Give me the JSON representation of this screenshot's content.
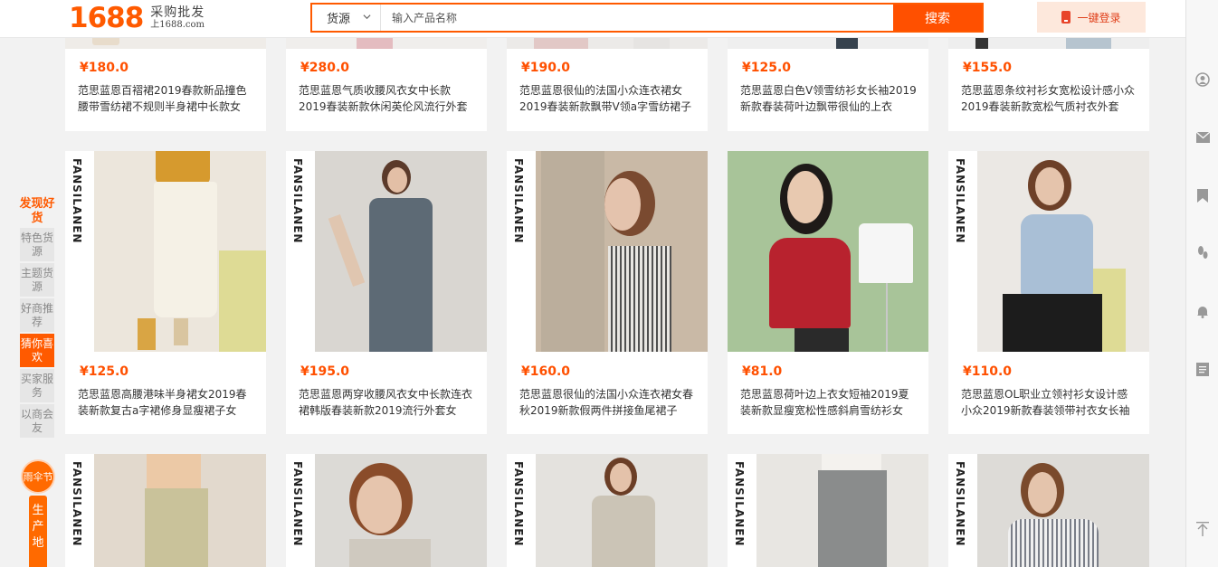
{
  "header": {
    "logo_number": "1688",
    "logo_slogan": "采购批发",
    "logo_url": "上1688.com",
    "search_category": "货源",
    "search_placeholder": "输入产品名称",
    "search_button": "搜索",
    "login_label": "一键登录"
  },
  "left_nav": {
    "title": "发现好货",
    "items": [
      {
        "label": "特色货源",
        "active": false
      },
      {
        "label": "主题货源",
        "active": false
      },
      {
        "label": "好商推荐",
        "active": false
      },
      {
        "label": "猜你喜欢",
        "active": true
      },
      {
        "label": "买家服务",
        "active": false
      },
      {
        "label": "以商会友",
        "active": false
      }
    ],
    "promo_circle": "雨伞节",
    "promo_bar": "生产地"
  },
  "right_bar": {
    "icons": [
      "user-icon",
      "mail-icon",
      "bookmark-icon",
      "footprint-icon",
      "bell-icon",
      "notes-icon",
      "back-to-top-icon"
    ]
  },
  "brand_watermark": "FANSILANEN",
  "products_row1": [
    {
      "price": "¥180.0",
      "title": "范思蓝恩百褶裙2019春款新品撞色腰带雪纺裙不规则半身裙中长款女"
    },
    {
      "price": "¥280.0",
      "title": "范思蓝恩气质收腰风衣女中长款2019春装新款休闲英伦风流行外套"
    },
    {
      "price": "¥190.0",
      "title": "范思蓝恩很仙的法国小众连衣裙女2019春装新款飘带V领a字雪纺裙子"
    },
    {
      "price": "¥125.0",
      "title": "范思蓝恩白色V领雪纺衫女长袖2019新款春装荷叶边飘带很仙的上衣"
    },
    {
      "price": "¥155.0",
      "title": "范思蓝恩条纹衬衫女宽松设计感小众2019春装新款宽松气质衬衣外套"
    }
  ],
  "products_row2": [
    {
      "price": "¥125.0",
      "title": "范思蓝恩高腰港味半身裙女2019春装新款复古a字裙修身显瘦裙子女"
    },
    {
      "price": "¥195.0",
      "title": "范思蓝恩两穿收腰风衣女中长款连衣裙韩版春装新款2019流行外套女"
    },
    {
      "price": "¥160.0",
      "title": "范思蓝恩很仙的法国小众连衣裙女春秋2019新款假两件拼接鱼尾裙子"
    },
    {
      "price": "¥81.0",
      "title": "范思蓝恩荷叶边上衣女短袖2019夏装新款显瘦宽松性感斜肩雪纺衫女"
    },
    {
      "price": "¥110.0",
      "title": "范思蓝恩OL职业立领衬衫女设计感小众2019新款春装领带衬衣女长袖"
    }
  ],
  "products_row3": [
    {
      "price": "",
      "title": ""
    },
    {
      "price": "",
      "title": ""
    },
    {
      "price": "",
      "title": ""
    },
    {
      "price": "",
      "title": ""
    },
    {
      "price": "",
      "title": ""
    }
  ],
  "colors": {
    "accent": "#ff5a00",
    "price": "#ff5000",
    "background": "#f2f2f2"
  }
}
